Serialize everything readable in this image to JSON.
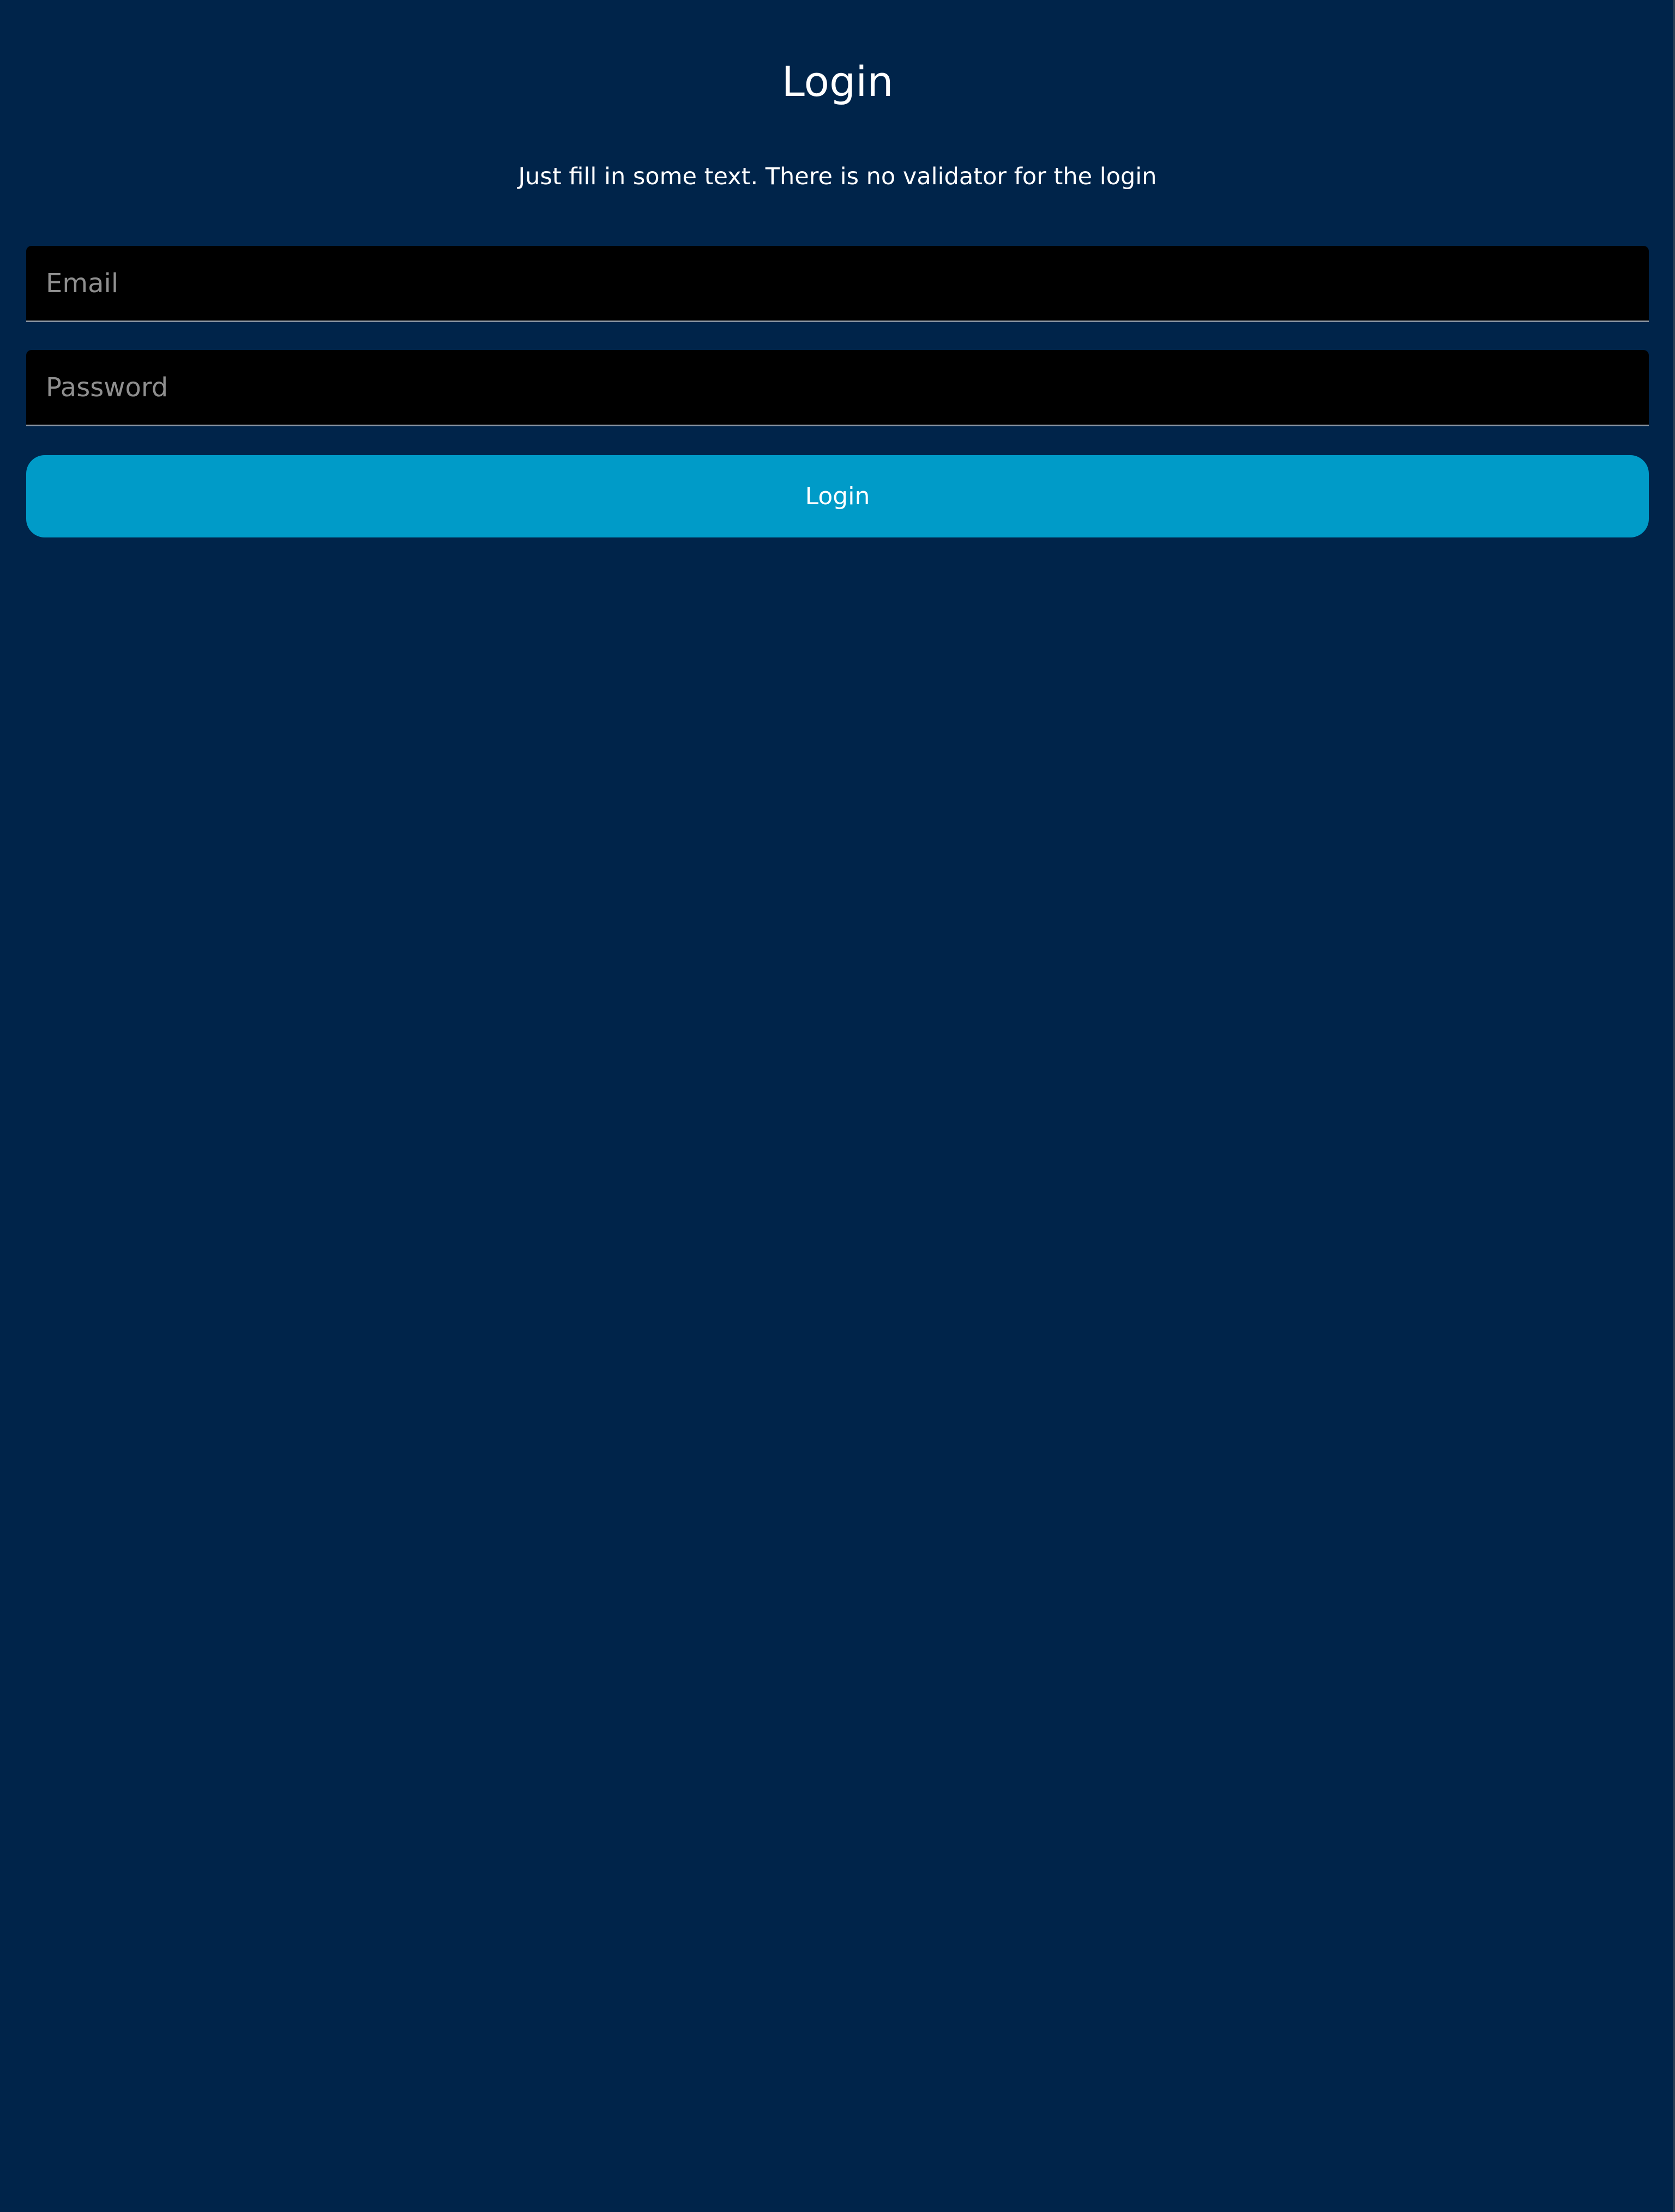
{
  "page": {
    "title": "Login",
    "subtitle": "Just fill in some text. There is no validator for the login"
  },
  "form": {
    "email": {
      "value": "",
      "placeholder": "Email"
    },
    "password": {
      "value": "",
      "placeholder": "Password"
    },
    "submit_label": "Login"
  },
  "colors": {
    "background": "#00244a",
    "input_background": "#000000",
    "input_underline": "#8b96a3",
    "placeholder_text": "#8f8f8f",
    "button_background": "#009bc8",
    "text": "#ffffff"
  }
}
